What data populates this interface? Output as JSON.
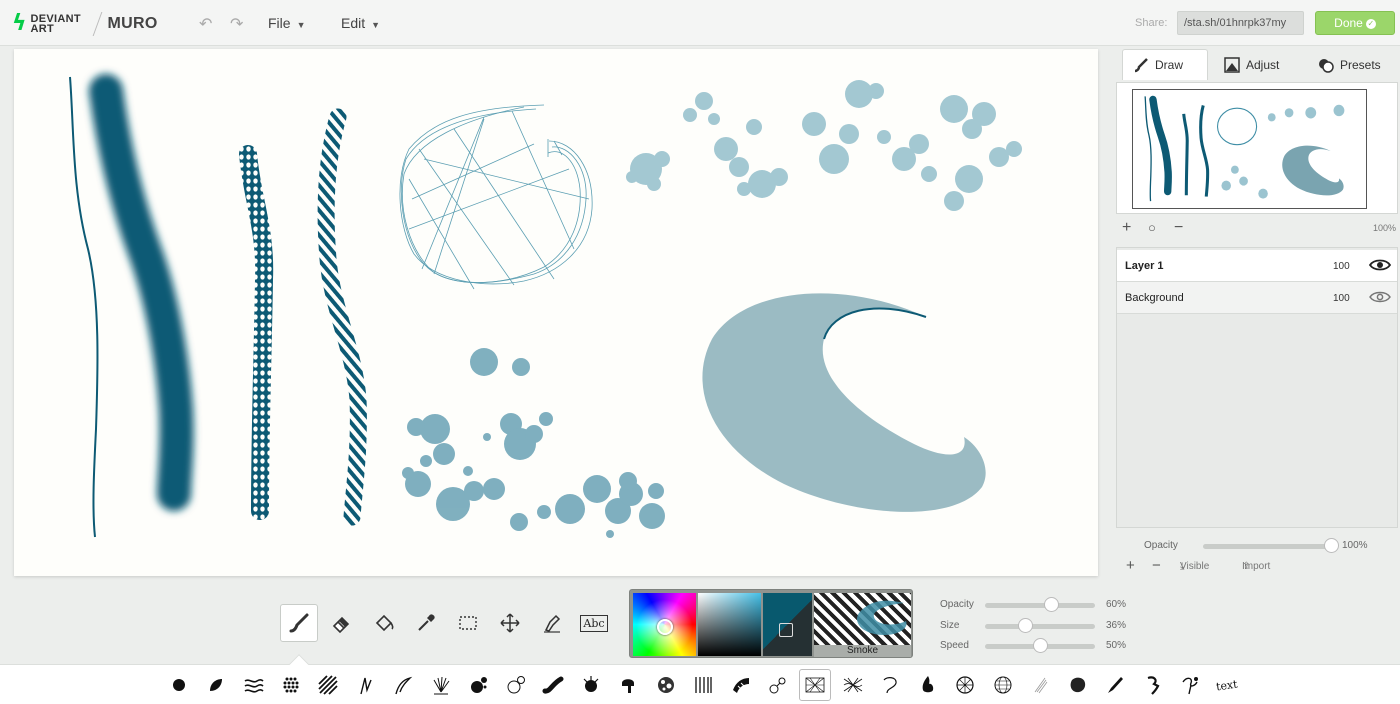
{
  "app": {
    "brand_line1": "DEVIANT",
    "brand_line2": "ART",
    "name": "MURO"
  },
  "menu": {
    "file": "File",
    "edit": "Edit"
  },
  "share": {
    "label": "Share:",
    "url": "/sta.sh/01hnrpk37my"
  },
  "done_label": "Done",
  "panel": {
    "tabs": [
      {
        "label": "Draw",
        "active": true
      },
      {
        "label": "Adjust",
        "active": false
      },
      {
        "label": "Presets",
        "active": false
      }
    ],
    "zoom": "100%",
    "layers": [
      {
        "name": "Layer 1",
        "opacity": "100",
        "visible": true,
        "active": true
      },
      {
        "name": "Background",
        "opacity": "100",
        "visible": true,
        "active": false
      }
    ],
    "opacity_label": "Opacity",
    "opacity_value": "100%",
    "visible_label": "Visible",
    "import_label": "Import"
  },
  "brush": {
    "name": "Smoke",
    "settings": [
      {
        "label": "Opacity",
        "value": "60%",
        "fraction": 0.6
      },
      {
        "label": "Size",
        "value": "36%",
        "fraction": 0.36
      },
      {
        "label": "Speed",
        "value": "50%",
        "fraction": 0.5
      }
    ]
  },
  "tools": [
    "brush-tool",
    "eraser-tool",
    "fill-tool",
    "eyedropper-tool",
    "select-tool",
    "move-tool",
    "smudge-tool",
    "text-tool"
  ],
  "text_tool_label": "Abc",
  "text_brush_label": "text",
  "colors": {
    "ink": "#0d5a74",
    "ink_light": "#3f8ea6",
    "accent_green": "#9bd66a",
    "brand_green": "#05cc47"
  }
}
